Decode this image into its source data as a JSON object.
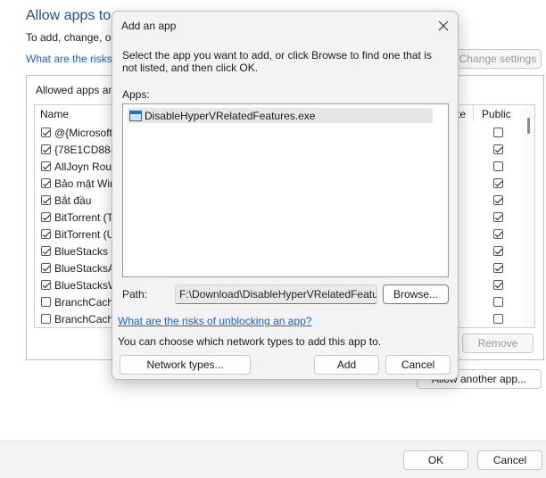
{
  "window": {
    "title": "Allow apps to",
    "subtitle": "To add, change, or",
    "risk_link": "What are the risks",
    "change_settings": "Change settings",
    "allowed_label": "Allowed apps and",
    "columns": {
      "name": "Name",
      "private": "te",
      "public": "Public"
    },
    "apps": [
      {
        "name": "@{Microsoft",
        "checked": true,
        "public": false
      },
      {
        "name": "{78E1CD88-4",
        "checked": true,
        "public": true
      },
      {
        "name": "AllJoyn Rout",
        "checked": true,
        "public": false
      },
      {
        "name": "Bảo mật Win",
        "checked": true,
        "public": true
      },
      {
        "name": "Bắt đầu",
        "checked": true,
        "public": true
      },
      {
        "name": "BitTorrent (T",
        "checked": true,
        "public": true
      },
      {
        "name": "BitTorrent (U",
        "checked": true,
        "public": true
      },
      {
        "name": "BlueStacks S",
        "checked": true,
        "public": true
      },
      {
        "name": "BlueStacksA",
        "checked": true,
        "public": true
      },
      {
        "name": "BlueStacksW",
        "checked": true,
        "public": true
      },
      {
        "name": "BranchCach",
        "checked": false,
        "public": false
      },
      {
        "name": "BranchCach",
        "checked": false,
        "public": false
      }
    ],
    "remove": "Remove",
    "allow_another": "Allow another app...",
    "ok": "OK",
    "cancel": "Cancel"
  },
  "dialog": {
    "title": "Add an app",
    "close_icon": "close-icon",
    "description": "Select the app you want to add, or click Browse to find one that is not listed, and then click OK.",
    "apps_label": "Apps:",
    "apps_list": [
      "DisableHyperVRelatedFeatures.exe"
    ],
    "path_label": "Path:",
    "path_value": "F:\\Download\\DisableHyperVRelatedFeatures.",
    "browse": "Browse...",
    "risk_link": "What are the risks of unblocking an app?",
    "network_text": "You can choose which network types to add this app to.",
    "network_types": "Network types...",
    "add": "Add",
    "cancel": "Cancel"
  }
}
